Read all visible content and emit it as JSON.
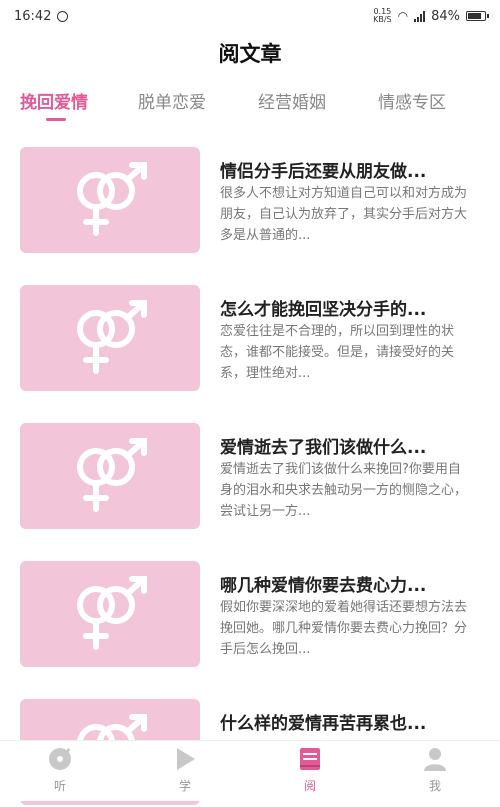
{
  "status_bar": {
    "time": "16:42",
    "net_speed_value": "0.15",
    "net_speed_unit": "KB/S",
    "battery": "84%",
    "battery_level": 0.84,
    "icons": [
      "alarm-icon",
      "wifi-icon",
      "signal-icon",
      "battery-icon"
    ]
  },
  "page_title": "阅文章",
  "tabs": [
    {
      "label": "挽回爱情",
      "active": true
    },
    {
      "label": "脱单恋爱",
      "active": false
    },
    {
      "label": "经营婚姻",
      "active": false
    },
    {
      "label": "情感专区",
      "active": false
    }
  ],
  "articles": [
    {
      "title": "情侣分手后还要从朋友做...",
      "excerpt": "很多人不想让对方知道自己可以和对方成为朋友，自己认为放弃了，其实分手后对方大多是从普通的..."
    },
    {
      "title": "怎么才能挽回坚决分手的...",
      "excerpt": "恋爱往往是不合理的，所以回到理性的状态，谁都不能接受。但是，请接受好的关系，理性绝对..."
    },
    {
      "title": "爱情逝去了我们该做什么...",
      "excerpt": "爱情逝去了我们该做什么来挽回?你要用自身的泪水和央求去触动另一方的恻隐之心，尝试让另一方..."
    },
    {
      "title": "哪几种爱情你要去费心力...",
      "excerpt": "假如你要深深地的爱着她得话还要想方法去挽回她。哪几种爱情你要去费心力挽回？分手后怎么挽回..."
    },
    {
      "title": "什么样的爱情再苦再累也...",
      "excerpt": ""
    }
  ],
  "thumbnail_icon": "gender-symbol-icon",
  "colors": {
    "accent": "#e35a97",
    "thumb_bg": "#f2c6d8",
    "nav_inactive": "#bbbbbb"
  },
  "bottom_nav": [
    {
      "label": "听",
      "icon": "disc-icon",
      "active": false
    },
    {
      "label": "学",
      "icon": "play-icon",
      "active": false
    },
    {
      "label": "阅",
      "icon": "book-icon",
      "active": true
    },
    {
      "label": "我",
      "icon": "user-icon",
      "active": false
    }
  ]
}
